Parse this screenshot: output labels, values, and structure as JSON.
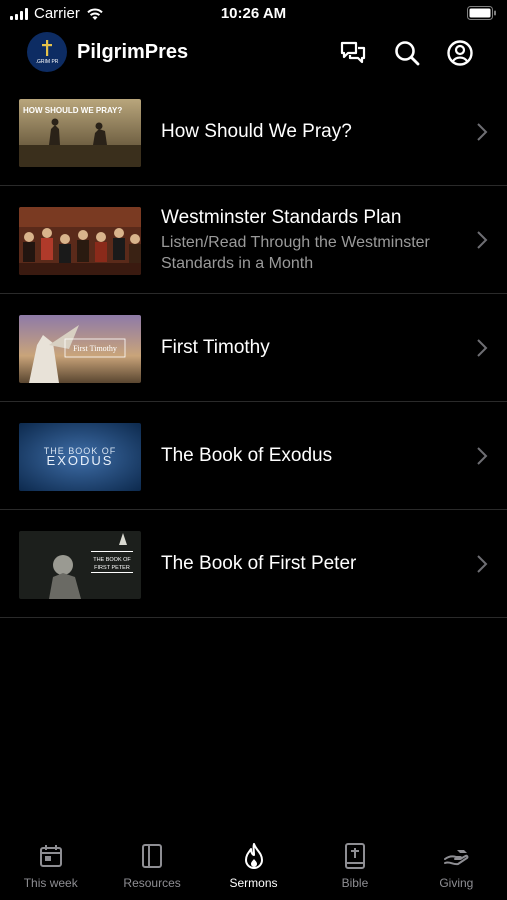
{
  "status_bar": {
    "carrier": "Carrier",
    "time": "10:26 AM"
  },
  "header": {
    "app_name": "PilgrimPres",
    "logo_text": ".GRIM PR"
  },
  "items": [
    {
      "title": "How Should We Pray?",
      "subtitle": "",
      "thumb_text": "HOW SHOULD WE PRAY?"
    },
    {
      "title": "Westminster Standards Plan",
      "subtitle": "Listen/Read Through the Westminster Standards in a Month",
      "thumb_text": ""
    },
    {
      "title": "First Timothy",
      "subtitle": "",
      "thumb_text": "First Timothy"
    },
    {
      "title": "The Book of Exodus",
      "subtitle": "",
      "thumb_text_top": "THE BOOK OF",
      "thumb_text_main": "EXODUS"
    },
    {
      "title": "The Book of First Peter",
      "subtitle": "",
      "thumb_text_top": "THE BOOK OF",
      "thumb_text_main": "FIRST PETER"
    }
  ],
  "tabs": [
    {
      "label": "This week",
      "icon": "calendar-icon",
      "active": false
    },
    {
      "label": "Resources",
      "icon": "book-panel-icon",
      "active": false
    },
    {
      "label": "Sermons",
      "icon": "flame-icon",
      "active": true
    },
    {
      "label": "Bible",
      "icon": "bible-icon",
      "active": false
    },
    {
      "label": "Giving",
      "icon": "giving-hand-icon",
      "active": false
    }
  ],
  "colors": {
    "background": "#000000",
    "separator": "#2a2a2a",
    "inactive_tab": "#8e8e93",
    "logo_bg": "#0d2c63"
  }
}
